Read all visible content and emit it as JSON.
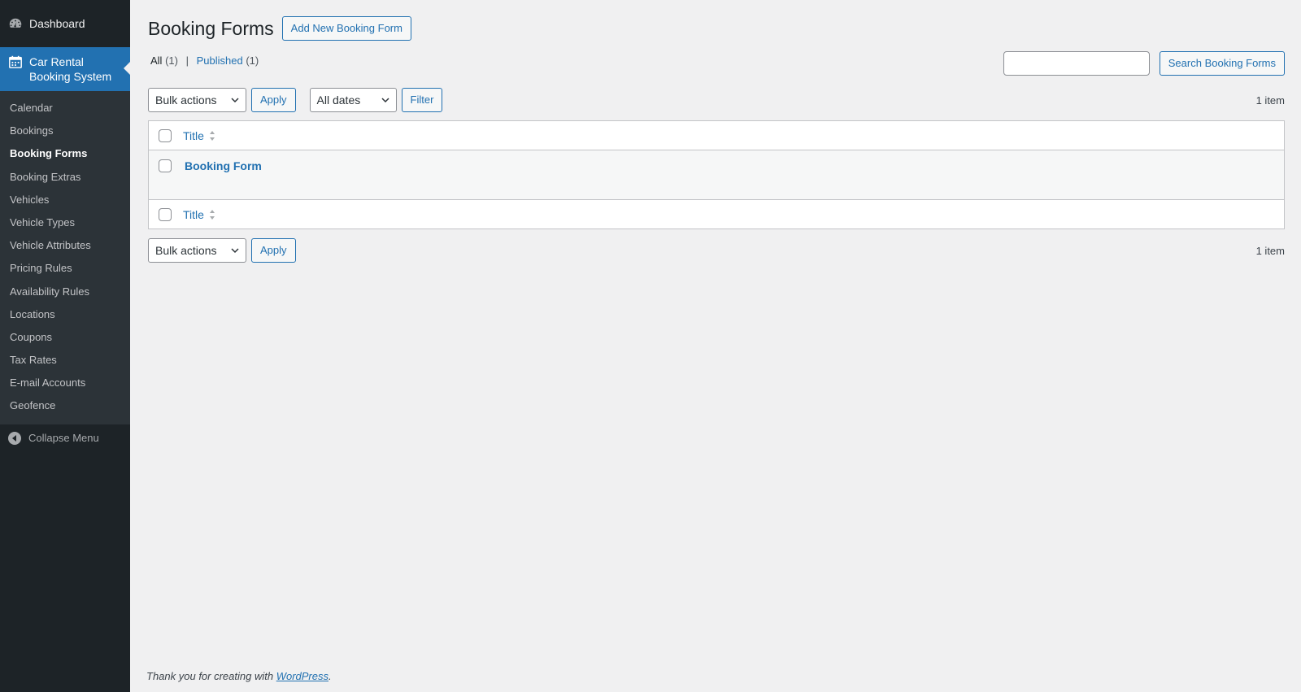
{
  "sidebar": {
    "dashboard_label": "Dashboard",
    "plugin_label_line1": "Car Rental",
    "plugin_label_line2": "Booking System",
    "items": [
      {
        "label": "Calendar"
      },
      {
        "label": "Bookings"
      },
      {
        "label": "Booking Forms"
      },
      {
        "label": "Booking Extras"
      },
      {
        "label": "Vehicles"
      },
      {
        "label": "Vehicle Types"
      },
      {
        "label": "Vehicle Attributes"
      },
      {
        "label": "Pricing Rules"
      },
      {
        "label": "Availability Rules"
      },
      {
        "label": "Locations"
      },
      {
        "label": "Coupons"
      },
      {
        "label": "Tax Rates"
      },
      {
        "label": "E-mail Accounts"
      },
      {
        "label": "Geofence"
      }
    ],
    "current_item": "Booking Forms",
    "collapse_label": "Collapse Menu"
  },
  "header": {
    "title": "Booking Forms",
    "add_new_label": "Add New Booking Form"
  },
  "views": {
    "all_label": "All",
    "all_count": "(1)",
    "separator": "|",
    "published_label": "Published",
    "published_count": "(1)"
  },
  "search": {
    "value": "",
    "button_label": "Search Booking Forms"
  },
  "tablenav_top": {
    "bulk_actions": "Bulk actions",
    "apply_label": "Apply",
    "dates_filter": "All dates",
    "filter_label": "Filter",
    "count": "1 item"
  },
  "table": {
    "column_title": "Title",
    "rows": [
      {
        "title": "Booking Form"
      }
    ]
  },
  "tablenav_bottom": {
    "bulk_actions": "Bulk actions",
    "apply_label": "Apply",
    "count": "1 item"
  },
  "footer": {
    "prefix": "Thank you for creating with ",
    "link": "WordPress",
    "suffix": "."
  },
  "colors": {
    "sidebar_bg": "#1d2327",
    "accent": "#2271b1",
    "page_bg": "#f0f0f1"
  }
}
